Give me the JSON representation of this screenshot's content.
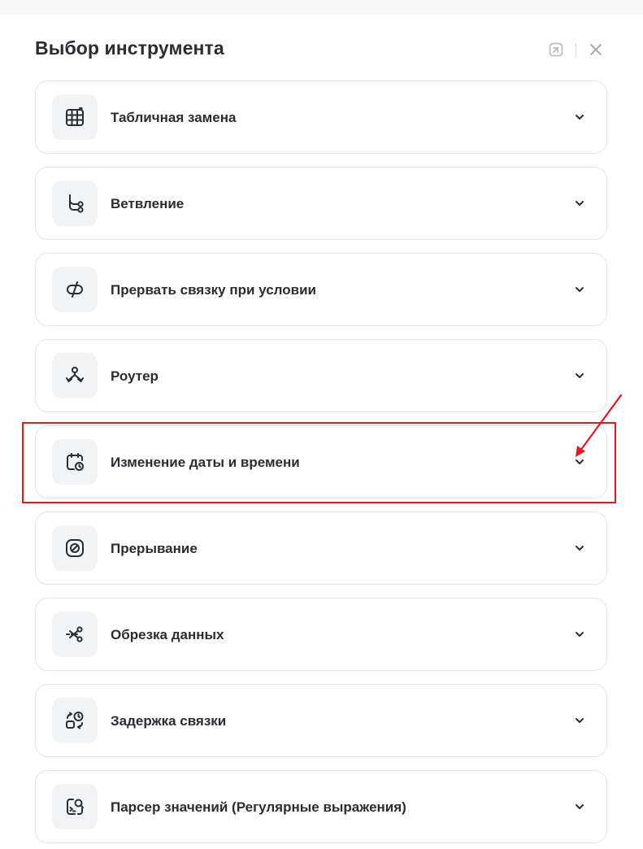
{
  "dialog": {
    "title": "Выбор инструмента"
  },
  "header": {
    "expand_icon": "expand-corner-icon",
    "close_icon": "close-icon"
  },
  "tools": [
    {
      "label": "Табличная замена",
      "icon": "table-grid-icon"
    },
    {
      "label": "Ветвление",
      "icon": "branch-icon"
    },
    {
      "label": "Прервать связку при условии",
      "icon": "break-link-icon"
    },
    {
      "label": "Роутер",
      "icon": "router-icon"
    },
    {
      "label": "Изменение даты и времени",
      "icon": "calendar-clock-icon"
    },
    {
      "label": "Прерывание",
      "icon": "interrupt-icon"
    },
    {
      "label": "Обрезка данных",
      "icon": "scissors-icon"
    },
    {
      "label": "Задержка связки",
      "icon": "delay-icon"
    },
    {
      "label": "Парсер значений (Регулярные выражения)",
      "icon": "regex-parser-icon"
    }
  ],
  "annotation": {
    "color": "#e3191d",
    "highlighted_tool_index": 4
  },
  "colors": {
    "text": "#2b2d33",
    "card_border": "#e3e5e9",
    "icon_bg": "#f2f3f5"
  }
}
